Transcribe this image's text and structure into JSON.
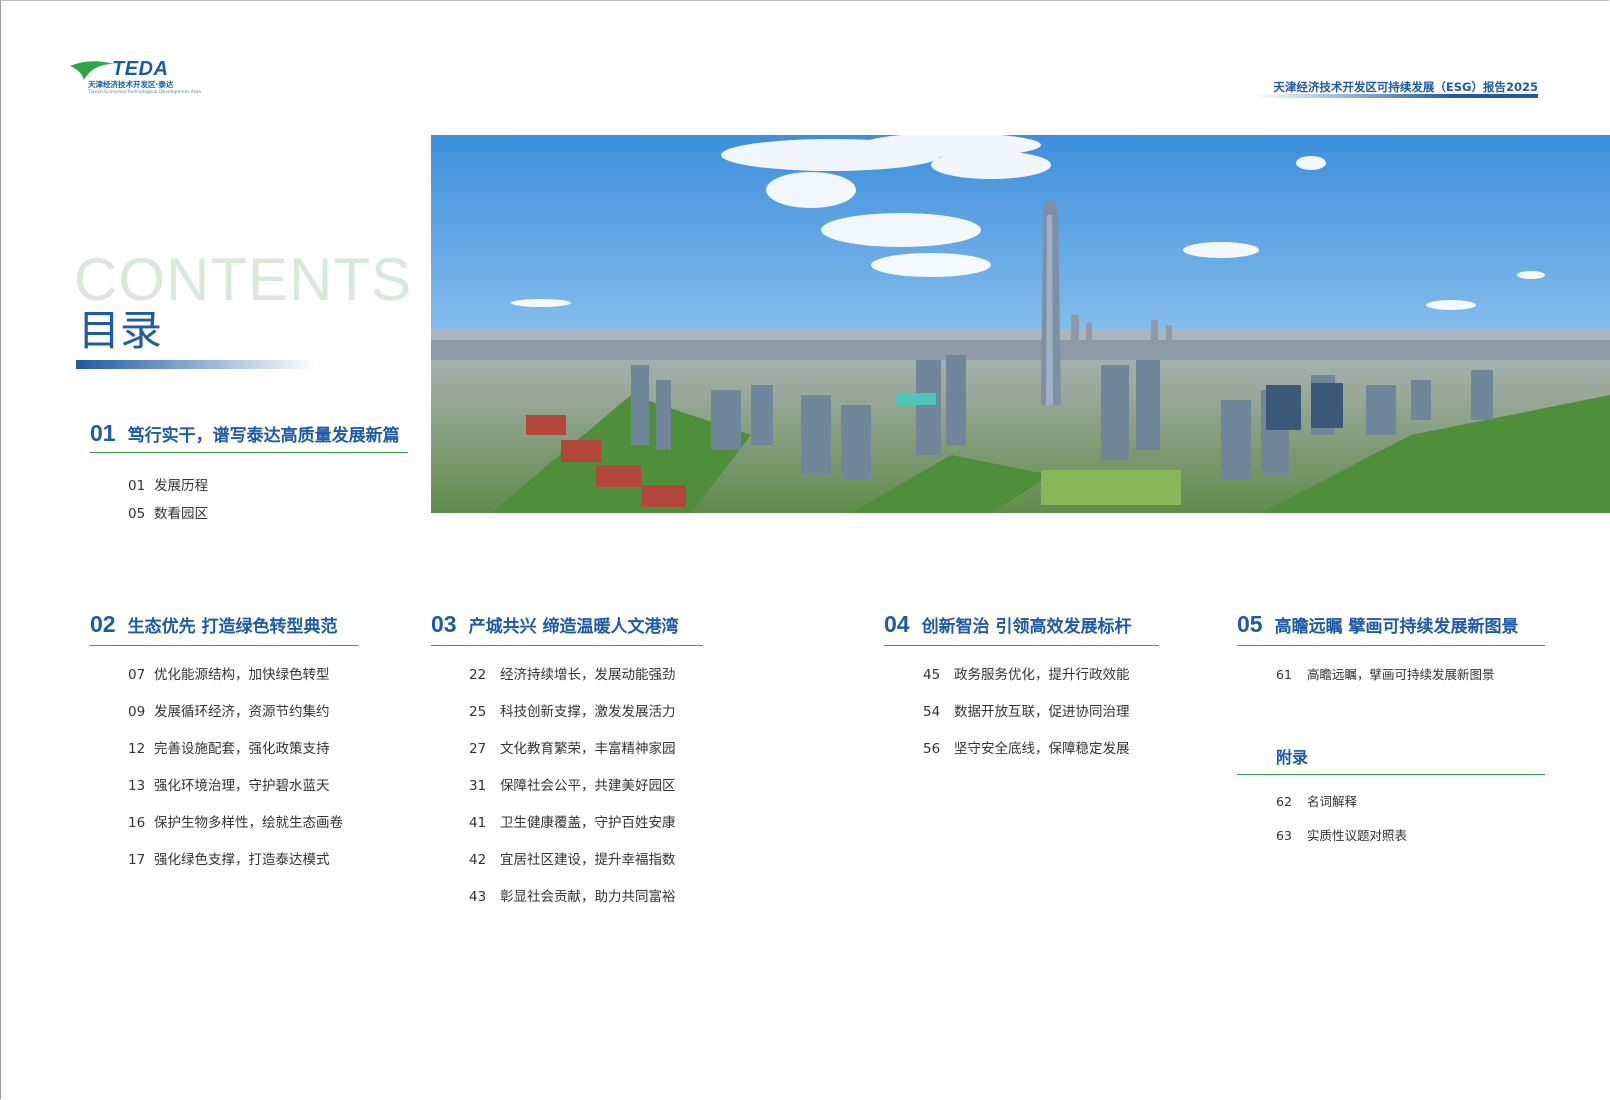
{
  "logo": {
    "brand": "TEDA",
    "subtitle": "天津经济技术开发区·泰达",
    "subtitle_en": "Tianjin Economic-Technological Development Area"
  },
  "report_title": "天津经济技术开发区可持续发展（ESG）报告2025",
  "heading": {
    "en": "CONTENTS",
    "zh": "目录"
  },
  "sections": [
    {
      "num": "01",
      "title": "笃行实干，谱写泰达高质量发展新篇",
      "items": [
        {
          "page": "01",
          "label": "发展历程"
        },
        {
          "page": "05",
          "label": "数看园区"
        }
      ]
    },
    {
      "num": "02",
      "title": "生态优先 打造绿色转型典范",
      "items": [
        {
          "page": "07",
          "label": "优化能源结构，加快绿色转型"
        },
        {
          "page": "09",
          "label": "发展循环经济，资源节约集约"
        },
        {
          "page": "12",
          "label": "完善设施配套，强化政策支持"
        },
        {
          "page": "13",
          "label": "强化环境治理，守护碧水蓝天"
        },
        {
          "page": "16",
          "label": "保护生物多样性，绘就生态画卷"
        },
        {
          "page": "17",
          "label": "强化绿色支撑，打造泰达模式"
        }
      ]
    },
    {
      "num": "03",
      "title": "产城共兴 缔造温暖人文港湾",
      "items": [
        {
          "page": "22",
          "label": "经济持续增长，发展动能强劲"
        },
        {
          "page": "25",
          "label": "科技创新支撑，激发发展活力"
        },
        {
          "page": "27",
          "label": "文化教育繁荣，丰富精神家园"
        },
        {
          "page": "31",
          "label": "保障社会公平，共建美好园区"
        },
        {
          "page": "41",
          "label": "卫生健康覆盖，守护百姓安康"
        },
        {
          "page": "42",
          "label": "宜居社区建设，提升幸福指数"
        },
        {
          "page": "43",
          "label": "彰显社会贡献，助力共同富裕"
        }
      ]
    },
    {
      "num": "04",
      "title": "创新智治 引领高效发展标杆",
      "items": [
        {
          "page": "45",
          "label": "政务服务优化，提升行政效能"
        },
        {
          "page": "54",
          "label": "数据开放互联，促进协同治理"
        },
        {
          "page": "56",
          "label": "坚守安全底线，保障稳定发展"
        }
      ]
    },
    {
      "num": "05",
      "title": "高瞻远瞩 擘画可持续发展新图景",
      "items": [
        {
          "page": "61",
          "label": "高瞻远瞩，擘画可持续发展新图景"
        }
      ]
    }
  ],
  "appendix": {
    "title": "附录",
    "items": [
      {
        "page": "62",
        "label": "名词解释"
      },
      {
        "page": "63",
        "label": "实质性议题对照表"
      }
    ]
  }
}
